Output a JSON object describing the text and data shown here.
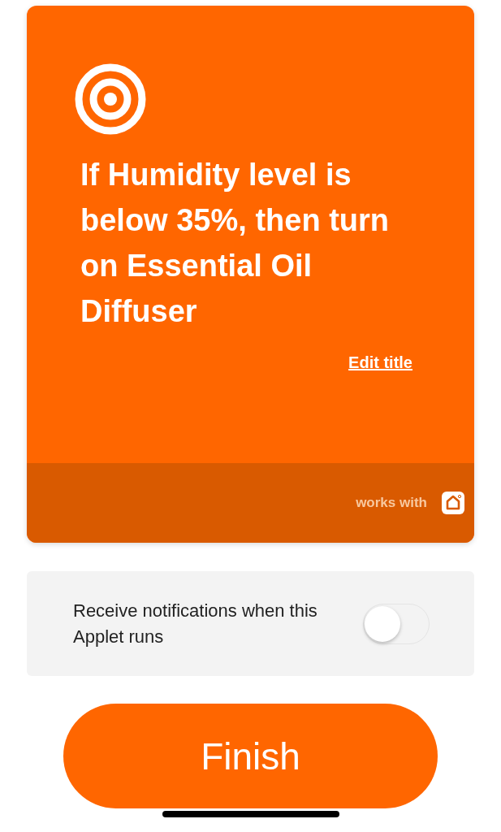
{
  "applet": {
    "title": "If Humidity level is below 35%, then turn on Essential Oil Diffuser",
    "edit_link": "Edit title",
    "works_with": "works with"
  },
  "notification": {
    "label": "Receive notifications when this Applet runs",
    "on": false
  },
  "finish_button": "Finish"
}
